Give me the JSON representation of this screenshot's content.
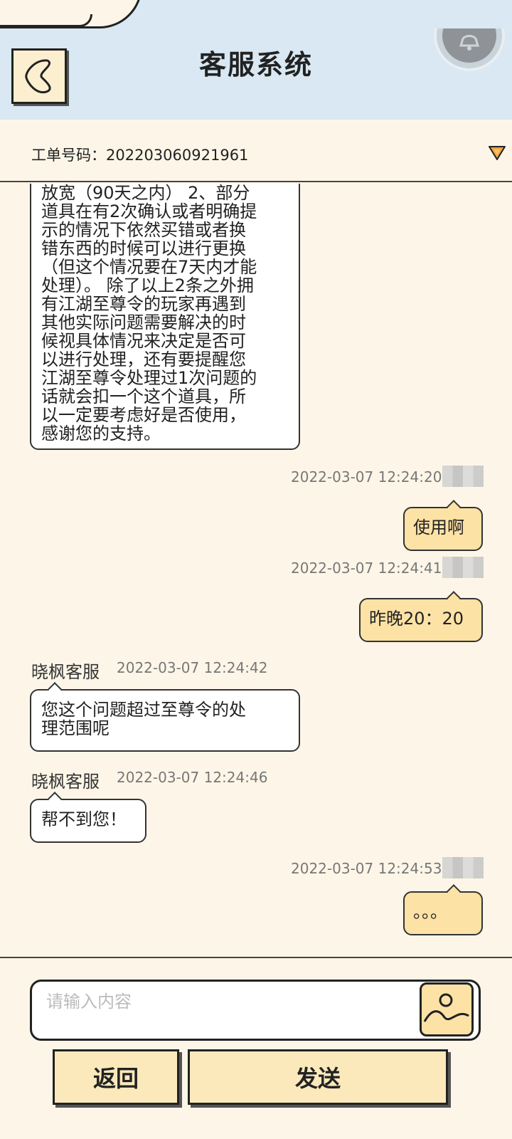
{
  "header": {
    "title": "客服系统",
    "back_icon": "chevron-left-icon",
    "bell_icon": "bell-icon"
  },
  "ticket": {
    "label": "工单号码：202203060921961",
    "dropdown_icon": "triangle-down-icon"
  },
  "messages": [
    {
      "side": "left",
      "lines": [
        "放宽（90天之内） 2、部分",
        "道具在有2次确认或者明确提",
        "示的情况下依然买错或者换",
        "错东西的时候可以进行更换",
        "（但这个情况要在7天内才能",
        "处理）。 除了以上2条之外拥",
        "有江湖至尊令的玩家再遇到",
        "其他实际问题需要解决的时",
        "候视具体情况来决定是否可",
        "以进行处理，还有要提醒您",
        "江湖至尊令处理过1次问题的",
        "话就会扣一个这个道具，所",
        "以一定要考虑好是否使用，",
        "感谢您的支持。"
      ]
    },
    {
      "side": "right",
      "time": "2022-03-07 12:24:20",
      "text": "使用啊"
    },
    {
      "side": "right",
      "time": "2022-03-07 12:24:41",
      "text": "昨晚20：20"
    },
    {
      "side": "left",
      "name": "晓枫客服",
      "time": "2022-03-07 12:24:42",
      "lines": [
        "您这个问题超过至尊令的处",
        "理范围呢"
      ]
    },
    {
      "side": "left",
      "name": "晓枫客服",
      "time": "2022-03-07 12:24:46",
      "lines": [
        "帮不到您！"
      ]
    },
    {
      "side": "right",
      "time": "2022-03-07 12:24:53",
      "text": "。。。"
    }
  ],
  "input": {
    "placeholder": "请输入内容",
    "value": "",
    "image_icon": "image-icon"
  },
  "buttons": {
    "back_label": "返回",
    "send_label": "发送"
  },
  "colors": {
    "background": "#fdf6e8",
    "header_bg": "#d9e8f2",
    "user_bubble": "#fde2a6",
    "button_bg": "#fbe9bc",
    "accent_dropdown": "#f2a23a"
  }
}
